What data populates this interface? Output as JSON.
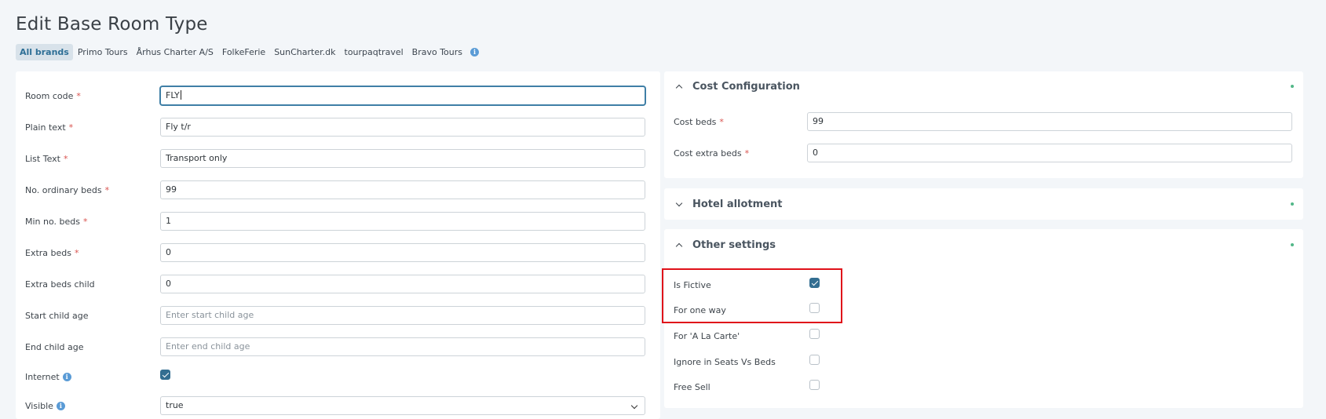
{
  "page": {
    "title": "Edit Base Room Type"
  },
  "brands": [
    "All brands",
    "Primo Tours",
    "Århus Charter A/S",
    "FolkeFerie",
    "SunCharter.dk",
    "tourpaqtravel",
    "Bravo Tours"
  ],
  "form": {
    "room_code": {
      "label": "Room code",
      "value": "FLY"
    },
    "plain_text": {
      "label": "Plain text",
      "value": "Fly t/r"
    },
    "list_text": {
      "label": "List Text",
      "value": "Transport only"
    },
    "ordinary_beds": {
      "label": "No. ordinary beds",
      "value": "99"
    },
    "min_beds": {
      "label": "Min no. beds",
      "value": "1"
    },
    "extra_beds": {
      "label": "Extra beds",
      "value": "0"
    },
    "extra_beds_child": {
      "label": "Extra beds child",
      "value": "0"
    },
    "start_child_age": {
      "label": "Start child age",
      "placeholder": "Enter start child age"
    },
    "end_child_age": {
      "label": "End child age",
      "placeholder": "Enter end child age"
    },
    "internet": {
      "label": "Internet",
      "checked": true
    },
    "visible": {
      "label": "Visible",
      "value": "true"
    }
  },
  "cost_configuration": {
    "title": "Cost Configuration",
    "cost_beds": {
      "label": "Cost beds",
      "value": "99"
    },
    "cost_extra_beds": {
      "label": "Cost extra beds",
      "value": "0"
    }
  },
  "hotel_allotment": {
    "title": "Hotel allotment"
  },
  "other_settings": {
    "title": "Other settings",
    "is_fictive": {
      "label": "Is Fictive",
      "checked": true
    },
    "for_one_way": {
      "label": "For one way",
      "checked": false
    },
    "for_a_la_carte": {
      "label": "For 'A La Carte'",
      "checked": false
    },
    "ignore_seats_vs_beds": {
      "label": "Ignore in Seats Vs Beds",
      "checked": false
    },
    "free_sell": {
      "label": "Free Sell",
      "checked": false
    }
  },
  "colors": {
    "accent": "#336e91",
    "required": "#d9534f",
    "status": "#52b788",
    "highlight": "#e0111a"
  }
}
